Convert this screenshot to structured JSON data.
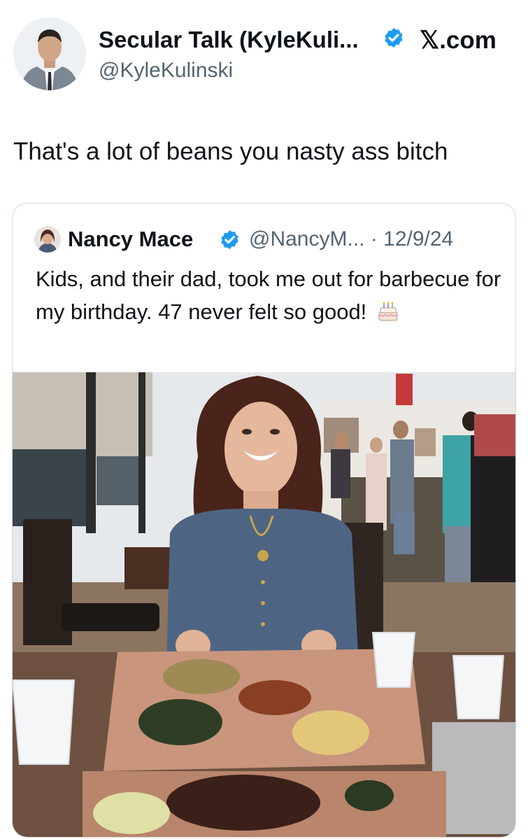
{
  "author": {
    "display_name": "Secular Talk (KyleKuli...",
    "handle": "@KyleKulinski",
    "verified": true,
    "avatar_icon": "profile-photo-man-in-suit"
  },
  "brand": {
    "site_label": "𝕏.com"
  },
  "tweet": {
    "text": "That's a lot of beans you nasty ass bitch"
  },
  "quoted_tweet": {
    "display_name": "Nancy Mace",
    "verified": true,
    "meta": "@NancyM... · 12/9/24",
    "text": "Kids, and their dad, took me out for barbecue for my birthday. 47 never felt so good!",
    "emoji_icon": "birthday-cake-icon",
    "photo_icon": "photo-woman-at-barbecue-restaurant-table"
  },
  "colors": {
    "verified_blue": "#1d9bf0",
    "secondary_text": "#536471",
    "border": "#cfd9de"
  }
}
